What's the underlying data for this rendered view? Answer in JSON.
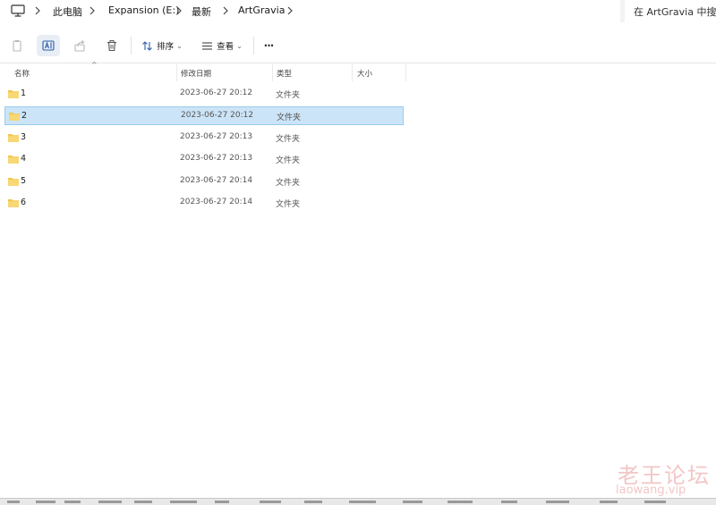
{
  "breadcrumb": {
    "items": [
      "此电脑",
      "Expansion (E:)",
      "最新",
      "ArtGravia"
    ]
  },
  "search": {
    "placeholder": "在 ArtGravia 中搜索"
  },
  "toolbar": {
    "sort_label": "排序",
    "view_label": "查看",
    "more_label": "···"
  },
  "columns": {
    "name": "名称",
    "modified": "修改日期",
    "type": "类型",
    "size": "大小"
  },
  "files": [
    {
      "name": "1",
      "modified": "2023-06-27 20:12",
      "type": "文件夹",
      "selected": false
    },
    {
      "name": "2",
      "modified": "2023-06-27 20:12",
      "type": "文件夹",
      "selected": true
    },
    {
      "name": "3",
      "modified": "2023-06-27 20:13",
      "type": "文件夹",
      "selected": false
    },
    {
      "name": "4",
      "modified": "2023-06-27 20:13",
      "type": "文件夹",
      "selected": false
    },
    {
      "name": "5",
      "modified": "2023-06-27 20:14",
      "type": "文件夹",
      "selected": false
    },
    {
      "name": "6",
      "modified": "2023-06-27 20:14",
      "type": "文件夹",
      "selected": false
    }
  ],
  "watermark": {
    "cn": "老王论坛",
    "en": "laowang.vip"
  },
  "colors": {
    "selection": "#cce4f7",
    "folder": "#f4c64e",
    "accent": "#0067c0"
  }
}
